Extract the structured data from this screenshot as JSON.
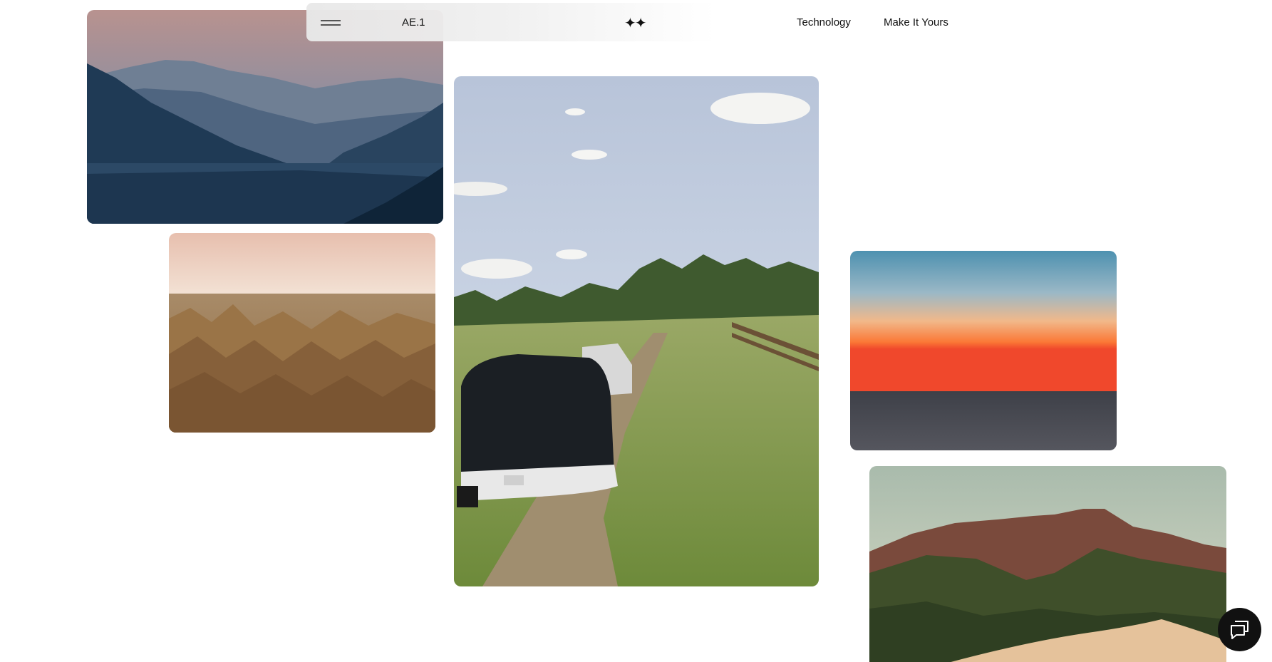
{
  "nav": {
    "menu_icon": "hamburger-icon",
    "model_label": "AE.1",
    "logo_glyph": "✦✦",
    "links": [
      {
        "label": "Technology"
      },
      {
        "label": "Make It Yours"
      }
    ]
  },
  "chat": {
    "icon": "chat-bubbles-icon"
  },
  "photos": [
    {
      "subject": "mountain-lake"
    },
    {
      "subject": "badlands"
    },
    {
      "subject": "trailer"
    },
    {
      "subject": "sunset"
    },
    {
      "subject": "dunes"
    }
  ]
}
